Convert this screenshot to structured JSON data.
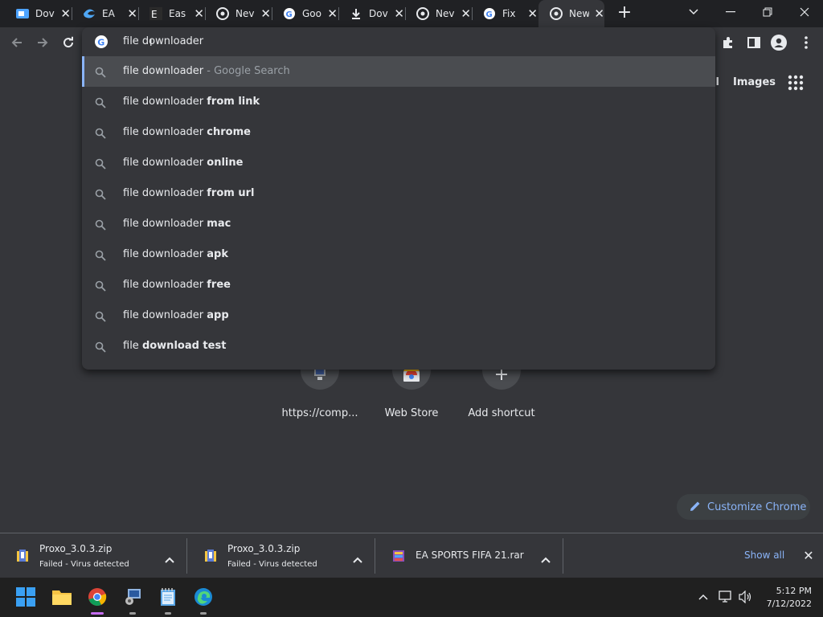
{
  "tabs": [
    {
      "title": "Dov",
      "icon": "video-icon"
    },
    {
      "title": "EA",
      "icon": "edge-icon"
    },
    {
      "title": "Eas",
      "icon": "easy-icon"
    },
    {
      "title": "Nev",
      "icon": "chrome-icon"
    },
    {
      "title": "Goo",
      "icon": "google-icon"
    },
    {
      "title": "Dov",
      "icon": "download-icon"
    },
    {
      "title": "Nev",
      "icon": "chrome-icon"
    },
    {
      "title": "Fix",
      "icon": "google-icon"
    },
    {
      "title": "New",
      "icon": "chrome-icon",
      "active": true
    }
  ],
  "omnibox": {
    "typed": "file downloader",
    "suggestions": [
      {
        "plain": "file downloader",
        "bold": "",
        "hint": " - Google Search",
        "selected": true
      },
      {
        "plain": "file downloader ",
        "bold": "from link"
      },
      {
        "plain": "file downloader ",
        "bold": "chrome"
      },
      {
        "plain": "file downloader ",
        "bold": "online"
      },
      {
        "plain": "file downloader ",
        "bold": "from url"
      },
      {
        "plain": "file downloader ",
        "bold": "mac"
      },
      {
        "plain": "file downloader ",
        "bold": "apk"
      },
      {
        "plain": "file downloader ",
        "bold": "free"
      },
      {
        "plain": "file downloader ",
        "bold": "app"
      },
      {
        "plain": "file ",
        "bold": "download test"
      }
    ]
  },
  "page": {
    "gmail_partial": "il",
    "images_link": "Images",
    "shortcuts": [
      {
        "label": "https://comp...",
        "icon": "computer-icon"
      },
      {
        "label": "Web Store",
        "icon": "web-store-icon"
      },
      {
        "label": "Add shortcut",
        "icon": "plus-icon"
      }
    ],
    "customize_label": "Customize Chrome"
  },
  "downloads": {
    "items": [
      {
        "name": "Proxo_3.0.3.zip",
        "status": "Failed - Virus detected"
      },
      {
        "name": "Proxo_3.0.3.zip",
        "status": "Failed - Virus detected"
      },
      {
        "name": "EA SPORTS FIFA 21.rar",
        "status": ""
      }
    ],
    "show_all_label": "Show all"
  },
  "taskbar": {
    "time": "5:12 PM",
    "date": "7/12/2022"
  },
  "colors": {
    "accent": "#8ab4f8",
    "toolbar": "#35363a",
    "frame": "#202124"
  }
}
